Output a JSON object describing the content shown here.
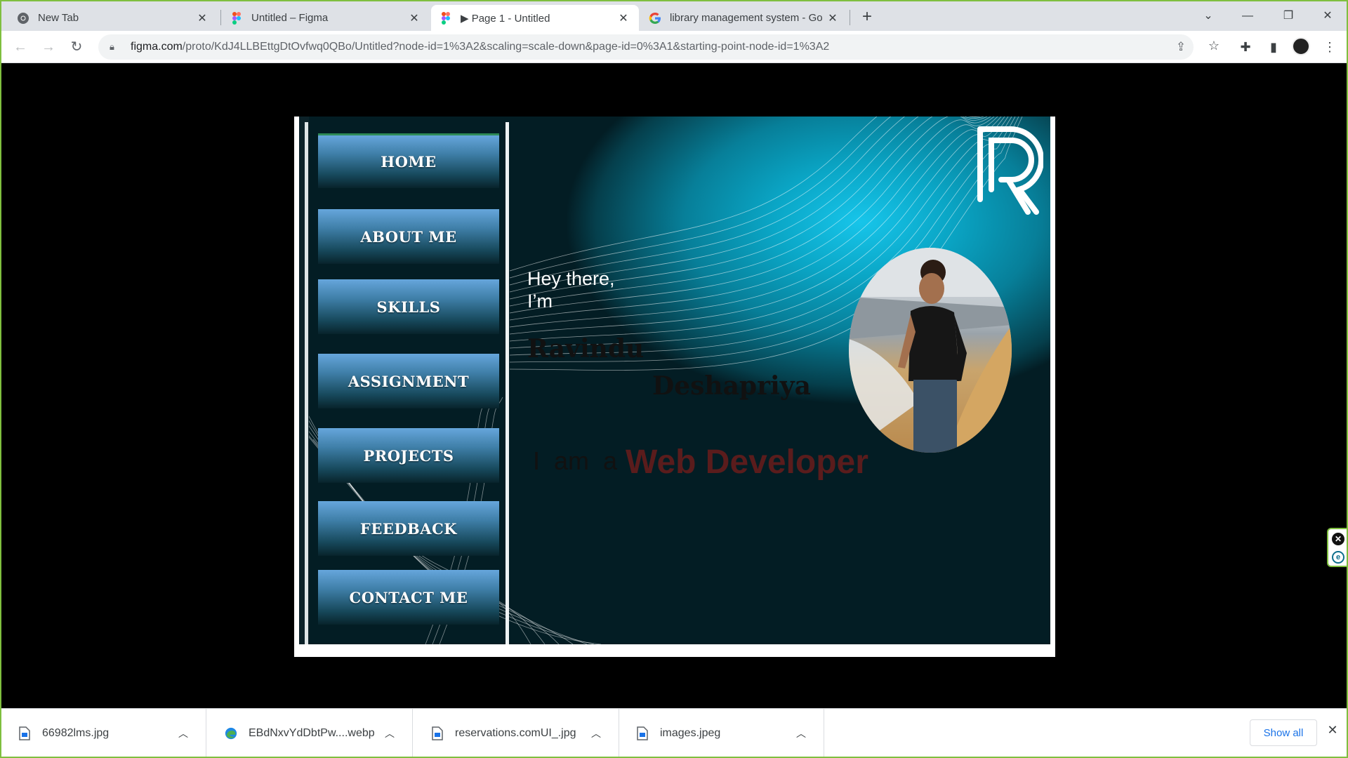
{
  "browser": {
    "tabs": [
      {
        "title": "New Tab",
        "icon": "chrome-icon"
      },
      {
        "title": "Untitled – Figma",
        "icon": "figma-icon"
      },
      {
        "title": "▶ Page 1 - Untitled",
        "icon": "figma-icon",
        "active": true
      },
      {
        "title": "library management system - Go",
        "icon": "google-icon"
      }
    ],
    "new_tab_label": "+",
    "url_host": "figma.com",
    "url_path": "/proto/KdJ4LLBEttgDtOvfwq0QBo/Untitled?node-id=1%3A2&scaling=scale-down&page-id=0%3A1&starting-point-node-id=1%3A2"
  },
  "site": {
    "nav": [
      "HOME",
      "ABOUT ME",
      "SKILLS",
      "ASSIGNMENT",
      "PROJECTS",
      "FEEDBACK",
      "CONTACT ME"
    ],
    "greeting_line1": "Hey there,",
    "greeting_line2": "I’m",
    "first_name": "Ravindu",
    "last_name": "Deshapriya",
    "intro": "I am a",
    "role": "Web Developer",
    "colors": {
      "role": "#5a1c1c",
      "accent": "#0aa6c6"
    }
  },
  "downloads": {
    "items": [
      {
        "name": "66982lms.jpg",
        "icon": "file-icon"
      },
      {
        "name": "EBdNxvYdDbtPw....webp",
        "icon": "edge-icon"
      },
      {
        "name": "reservations.comUI_.jpg",
        "icon": "file-icon"
      },
      {
        "name": "images.jpeg",
        "icon": "file-icon"
      }
    ],
    "show_all": "Show all"
  }
}
